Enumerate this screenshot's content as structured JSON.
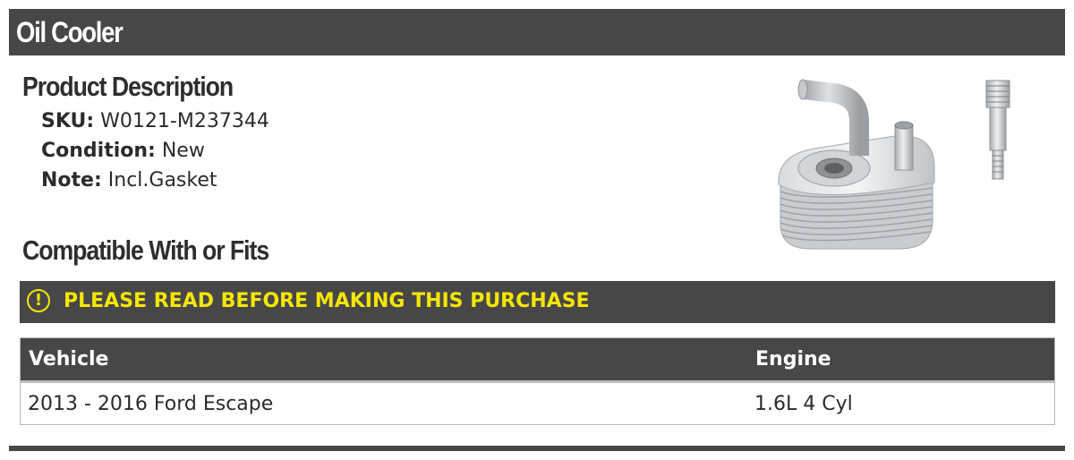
{
  "header": {
    "title": "Oil Cooler"
  },
  "description": {
    "heading": "Product Description",
    "sku_label": "SKU:",
    "sku_value": "W0121-M237344",
    "condition_label": "Condition:",
    "condition_value": "New",
    "note_label": "Note:",
    "note_value": "Incl.Gasket"
  },
  "fits": {
    "heading": "Compatible With or Fits",
    "warning_icon": "exclamation-circle-icon",
    "warning": "PLEASE READ BEFORE MAKING THIS PURCHASE",
    "columns": [
      "Vehicle",
      "Engine"
    ],
    "rows": [
      {
        "vehicle": "2013 - 2016 Ford Escape",
        "engine": "1.6L 4 Cyl"
      }
    ]
  },
  "colors": {
    "bar": "#474747",
    "warning_text": "#f5e600",
    "text": "#2b2b2b"
  }
}
